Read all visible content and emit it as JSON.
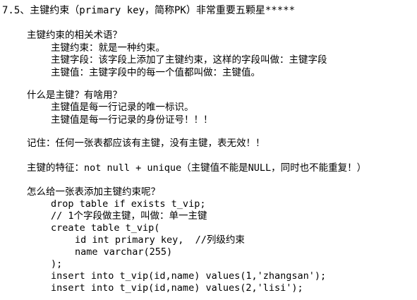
{
  "lines": [
    {
      "text": "7.5、主键约束（primary key，简称PK）非常重要五颗星*****"
    },
    {
      "text": "主键约束的相关术语？"
    },
    {
      "text": "主键约束：就是一种约束。"
    },
    {
      "text": "主键字段：该字段上添加了主键约束，这样的字段叫做：主键字段"
    },
    {
      "text": "主键值：主键字段中的每一个值都叫做：主键值。"
    },
    {
      "text": "什么是主键？有啥用？"
    },
    {
      "text": "主键值是每一行记录的唯一标识。"
    },
    {
      "text": "主键值是每一行记录的身份证号！！！"
    },
    {
      "text": "记住：任何一张表都应该有主键，没有主键，表无效！！"
    },
    {
      "text": "主键的特征：not null + unique（主键值不能是NULL，同时也不能重复！）"
    },
    {
      "text": "怎么给一张表添加主键约束呢？"
    },
    {
      "text": "drop table if exists t_vip;"
    },
    {
      "text": "// 1个字段做主键，叫做：单一主键"
    },
    {
      "text": "create table t_vip("
    },
    {
      "text": "id int primary key,  //列级约束"
    },
    {
      "text": "name varchar(255)"
    },
    {
      "text": ");"
    },
    {
      "text": "insert into t_vip(id,name) values(1,'zhangsan');"
    },
    {
      "text": "insert into t_vip(id,name) values(2,'lisi');"
    }
  ]
}
